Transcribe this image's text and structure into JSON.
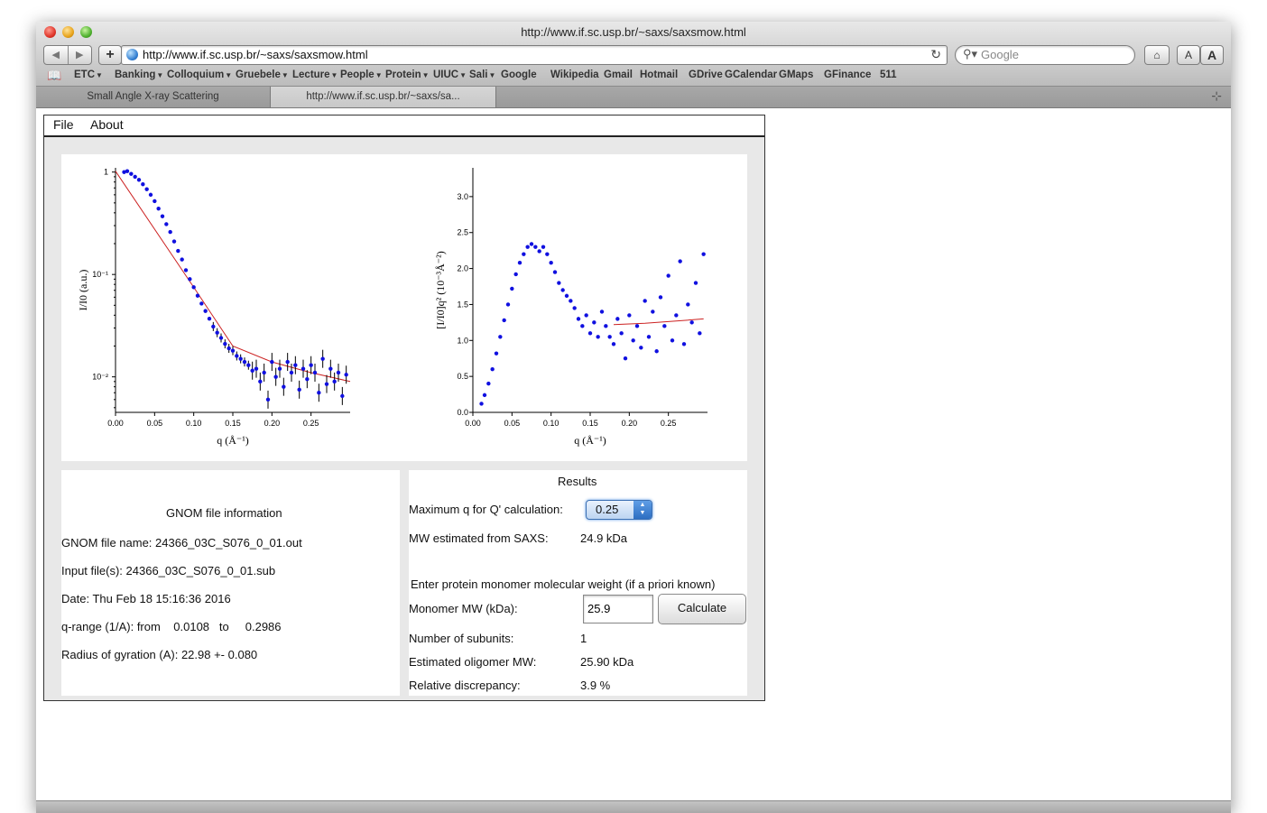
{
  "browser": {
    "window_title": "http://www.if.sc.usp.br/~saxs/saxsmow.html",
    "url": "http://www.if.sc.usp.br/~saxs/saxsmow.html",
    "search_placeholder": "Google",
    "bookmarks": [
      "ETC",
      "Banking",
      "Colloquium",
      "Gruebele",
      "Lecture",
      "People",
      "Protein",
      "UIUC",
      "Sali",
      "Google",
      "Wikipedia",
      "Gmail",
      "Hotmail",
      "GDrive",
      "GCalendar",
      "GMaps",
      "GFinance",
      "511"
    ],
    "bookmark_has_menu": [
      true,
      true,
      true,
      true,
      true,
      true,
      true,
      true,
      true,
      false,
      false,
      false,
      false,
      false,
      false,
      false,
      false,
      false
    ],
    "tabs": [
      {
        "label": "Small Angle X-ray Scattering",
        "active": false
      },
      {
        "label": "http://www.if.sc.usp.br/~saxs/sa...",
        "active": true
      }
    ],
    "text_size_buttons": [
      "A",
      "A"
    ]
  },
  "applet": {
    "menu": [
      "File",
      "About"
    ],
    "gnom": {
      "title": "GNOM file information",
      "file_name": "GNOM file name: 24366_03C_S076_0_01.out",
      "input_files": "Input file(s): 24366_03C_S076_0_01.sub",
      "date": "Date: Thu Feb 18 15:16:36 2016",
      "q_range": "q-range (1/A): from    0.0108   to     0.2986",
      "rg": "Radius of gyration (A): 22.98 +- 0.080"
    },
    "results": {
      "title": "Results",
      "max_q_label": "Maximum q for Q' calculation:",
      "max_q_value": "0.25",
      "mw_saxs_label": "MW estimated from SAXS:",
      "mw_saxs_value": "24.9 kDa",
      "enter_prompt": "Enter protein monomer molecular weight (if a priori known)",
      "monomer_label": "Monomer MW (kDa):",
      "monomer_value": "25.9",
      "calculate_label": "Calculate",
      "subunits_label": "Number of subunits:",
      "subunits_value": "1",
      "oligomer_label": "Estimated oligomer MW:",
      "oligomer_value": "25.90 kDa",
      "discrepancy_label": "Relative discrepancy:",
      "discrepancy_value": "3.9 %"
    }
  },
  "colors": {
    "points": "#1010e0",
    "fit": "#cc2222",
    "panel_bg": "#e8e8e8"
  },
  "chart_data": [
    {
      "type": "scatter",
      "title": "",
      "xlabel": "q (Å⁻¹)",
      "ylabel": "I/I0 (a.u.)",
      "log_y": true,
      "xlim": [
        0.0,
        0.3
      ],
      "ylim": [
        0.0045,
        1.1
      ],
      "x_ticks": [
        "0.00",
        "0.05",
        "0.10",
        "0.15",
        "0.20",
        "0.25"
      ],
      "y_ticks": [
        "1",
        "10⁻¹",
        "10⁻²"
      ],
      "error_bars": true,
      "series": [
        {
          "x": [
            0.011,
            0.015,
            0.02,
            0.025,
            0.03,
            0.035,
            0.04,
            0.045,
            0.05,
            0.055,
            0.06,
            0.065,
            0.07,
            0.075,
            0.08,
            0.085,
            0.09,
            0.095,
            0.1,
            0.105,
            0.11,
            0.115,
            0.12,
            0.125,
            0.13,
            0.135,
            0.14,
            0.145,
            0.15,
            0.155,
            0.16,
            0.165,
            0.17,
            0.175,
            0.18,
            0.185,
            0.19,
            0.195,
            0.2,
            0.205,
            0.21,
            0.215,
            0.22,
            0.225,
            0.23,
            0.235,
            0.24,
            0.245,
            0.25,
            0.255,
            0.26,
            0.265,
            0.27,
            0.275,
            0.28,
            0.285,
            0.29,
            0.295
          ],
          "y": [
            1.0,
            1.02,
            0.96,
            0.9,
            0.84,
            0.76,
            0.68,
            0.6,
            0.52,
            0.44,
            0.37,
            0.31,
            0.26,
            0.21,
            0.17,
            0.14,
            0.11,
            0.09,
            0.075,
            0.062,
            0.052,
            0.044,
            0.037,
            0.031,
            0.027,
            0.024,
            0.021,
            0.019,
            0.018,
            0.016,
            0.015,
            0.014,
            0.013,
            0.0115,
            0.012,
            0.009,
            0.011,
            0.006,
            0.014,
            0.01,
            0.012,
            0.008,
            0.014,
            0.011,
            0.013,
            0.0075,
            0.012,
            0.0095,
            0.013,
            0.011,
            0.007,
            0.015,
            0.0085,
            0.012,
            0.009,
            0.011,
            0.0065,
            0.0105
          ]
        },
        {
          "name": "",
          "x": [
            0.0,
            0.1,
            0.15,
            0.2,
            0.25,
            0.3
          ],
          "y": [
            1.02,
            0.075,
            0.02,
            0.014,
            0.011,
            0.009
          ],
          "style": "line"
        }
      ]
    },
    {
      "type": "scatter",
      "title": "",
      "xlabel": "q (Å⁻¹)",
      "ylabel": "[I/I0]q² (10⁻³Å⁻²)",
      "xlim": [
        0.0,
        0.3
      ],
      "ylim": [
        0.0,
        3.4
      ],
      "x_ticks": [
        "0.00",
        "0.05",
        "0.10",
        "0.15",
        "0.20",
        "0.25"
      ],
      "y_ticks": [
        "0.0",
        "0.5",
        "1.0",
        "1.5",
        "2.0",
        "2.5",
        "3.0"
      ],
      "series": [
        {
          "x": [
            0.011,
            0.015,
            0.02,
            0.025,
            0.03,
            0.035,
            0.04,
            0.045,
            0.05,
            0.055,
            0.06,
            0.065,
            0.07,
            0.075,
            0.08,
            0.085,
            0.09,
            0.095,
            0.1,
            0.105,
            0.11,
            0.115,
            0.12,
            0.125,
            0.13,
            0.135,
            0.14,
            0.145,
            0.15,
            0.155,
            0.16,
            0.165,
            0.17,
            0.175,
            0.18,
            0.185,
            0.19,
            0.195,
            0.2,
            0.205,
            0.21,
            0.215,
            0.22,
            0.225,
            0.23,
            0.235,
            0.24,
            0.245,
            0.25,
            0.255,
            0.26,
            0.265,
            0.27,
            0.275,
            0.28,
            0.285,
            0.29,
            0.295
          ],
          "y": [
            0.12,
            0.24,
            0.4,
            0.6,
            0.82,
            1.05,
            1.28,
            1.5,
            1.72,
            1.92,
            2.08,
            2.2,
            2.3,
            2.34,
            2.3,
            2.24,
            2.3,
            2.2,
            2.08,
            1.95,
            1.8,
            1.7,
            1.62,
            1.55,
            1.45,
            1.3,
            1.2,
            1.35,
            1.1,
            1.25,
            1.05,
            1.4,
            1.2,
            1.05,
            0.95,
            1.3,
            1.1,
            0.75,
            1.35,
            1.0,
            1.2,
            0.9,
            1.55,
            1.05,
            1.4,
            0.85,
            1.6,
            1.2,
            1.9,
            1.0,
            1.35,
            2.1,
            0.95,
            1.5,
            1.25,
            1.8,
            1.1,
            2.2
          ]
        },
        {
          "name": "",
          "x": [
            0.18,
            0.22,
            0.26,
            0.295
          ],
          "y": [
            1.22,
            1.24,
            1.27,
            1.3
          ],
          "style": "line"
        }
      ]
    }
  ]
}
